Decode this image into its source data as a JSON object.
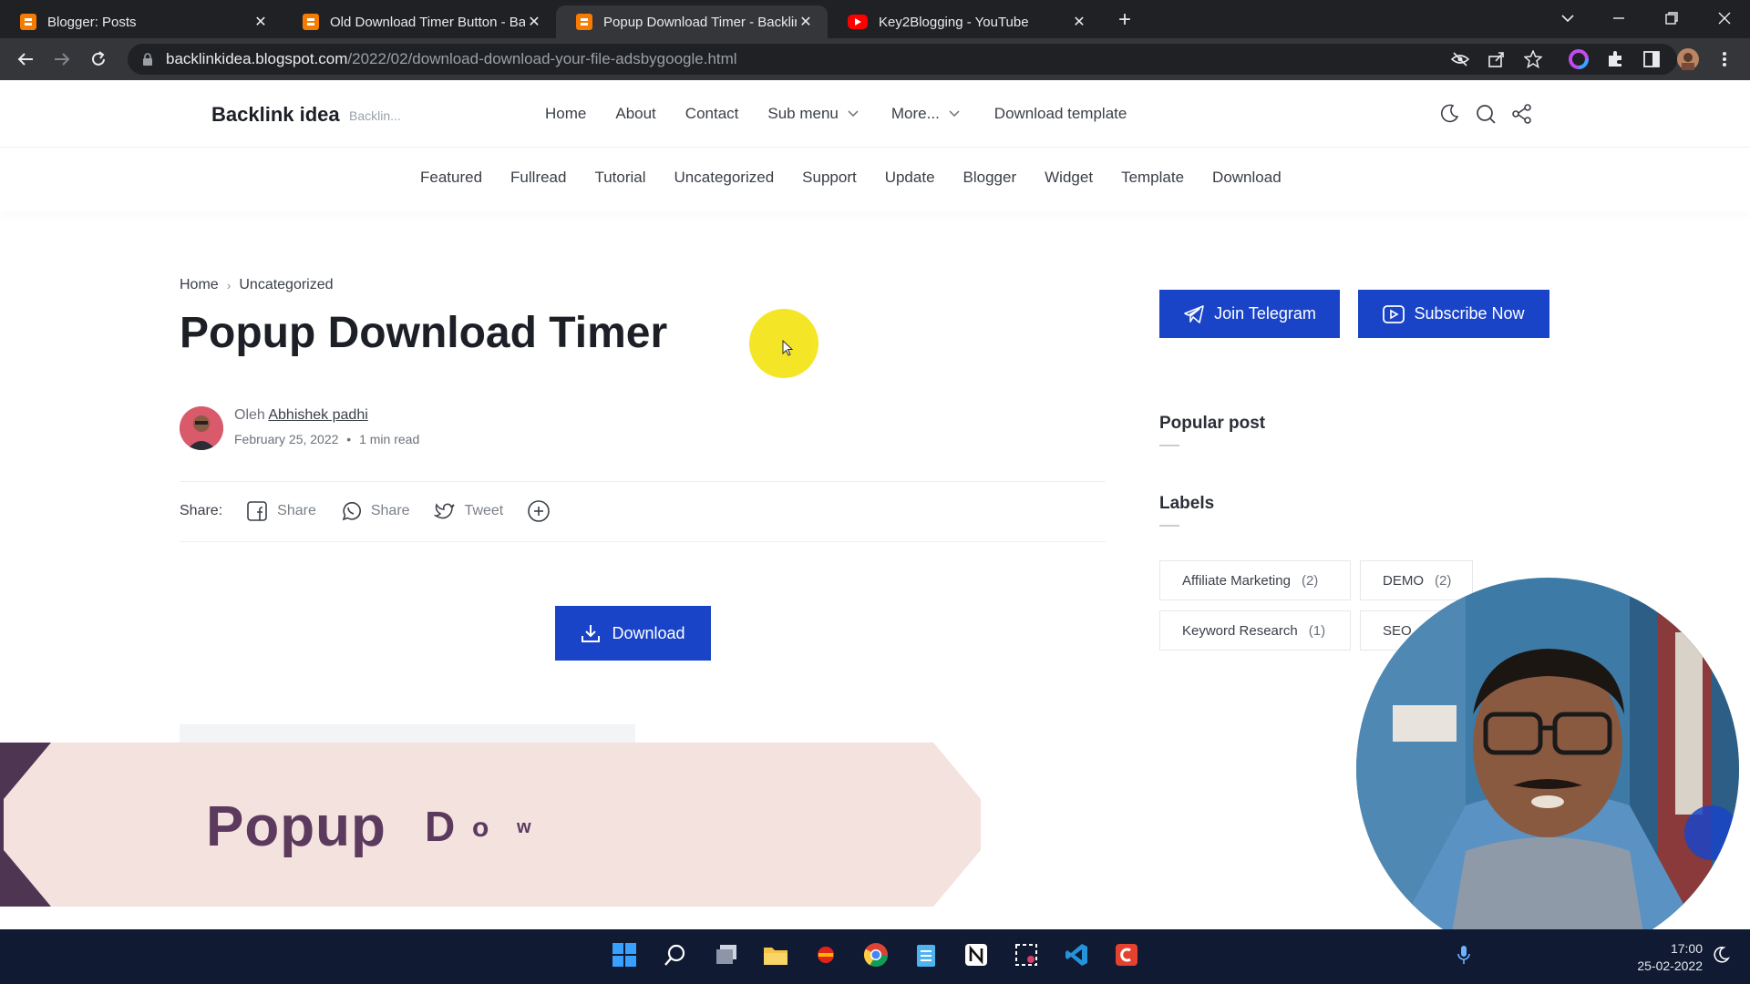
{
  "browser": {
    "tabs": [
      {
        "title": "Blogger: Posts",
        "icon": "blogger-icon"
      },
      {
        "title": "Old Download Timer Button - Ba",
        "icon": "blogger-icon"
      },
      {
        "title": "Popup Download Timer - Backlin",
        "icon": "blogger-icon",
        "active": true
      },
      {
        "title": "Key2Blogging - YouTube",
        "icon": "youtube-icon"
      }
    ],
    "url_host": "backlinkidea.blogspot.com",
    "url_path": "/2022/02/download-download-your-file-adsbygoogle.html"
  },
  "site": {
    "brand": "Backlink idea",
    "brand_sub": "Backlin...",
    "nav": {
      "home": "Home",
      "about": "About",
      "contact": "Contact",
      "submenu": "Sub menu",
      "more": "More...",
      "download_template": "Download template"
    },
    "subnav": [
      "Featured",
      "Fullread",
      "Tutorial",
      "Uncategorized",
      "Support",
      "Update",
      "Blogger",
      "Widget",
      "Template",
      "Download"
    ]
  },
  "post": {
    "breadcrumb_home": "Home",
    "breadcrumb_sep": "›",
    "breadcrumb_category": "Uncategorized",
    "title": "Popup Download Timer",
    "author_prefix": "Oleh",
    "author_name": "Abhishek padhi",
    "date": "February 25, 2022",
    "meta_sep": "•",
    "read_time": "1 min read",
    "share_label": "Share:",
    "share_facebook": "Share",
    "share_whatsapp": "Share",
    "share_twitter": "Tweet",
    "download_button": "Download"
  },
  "sidebar": {
    "join_telegram": "Join Telegram",
    "subscribe_now": "Subscribe Now",
    "popular_post": "Popular post",
    "labels_title": "Labels",
    "labels": [
      {
        "name": "Affiliate Marketing",
        "count": "(2)"
      },
      {
        "name": "DEMO",
        "count": "(2)"
      },
      {
        "name": "Keyword Research",
        "count": "(1)"
      },
      {
        "name": "SEO",
        "count": ""
      }
    ]
  },
  "overlay": {
    "word1": "Popup",
    "letter_d": "D",
    "letter_o": "o",
    "letter_w": "w"
  },
  "taskbar": {
    "time": "17:00",
    "date": "25-02-2022"
  },
  "colors": {
    "accent": "#1a44c8",
    "banner_bg": "#f3e2de",
    "banner_text": "#5b3a5e",
    "cursor_halo": "#f4e51c"
  }
}
